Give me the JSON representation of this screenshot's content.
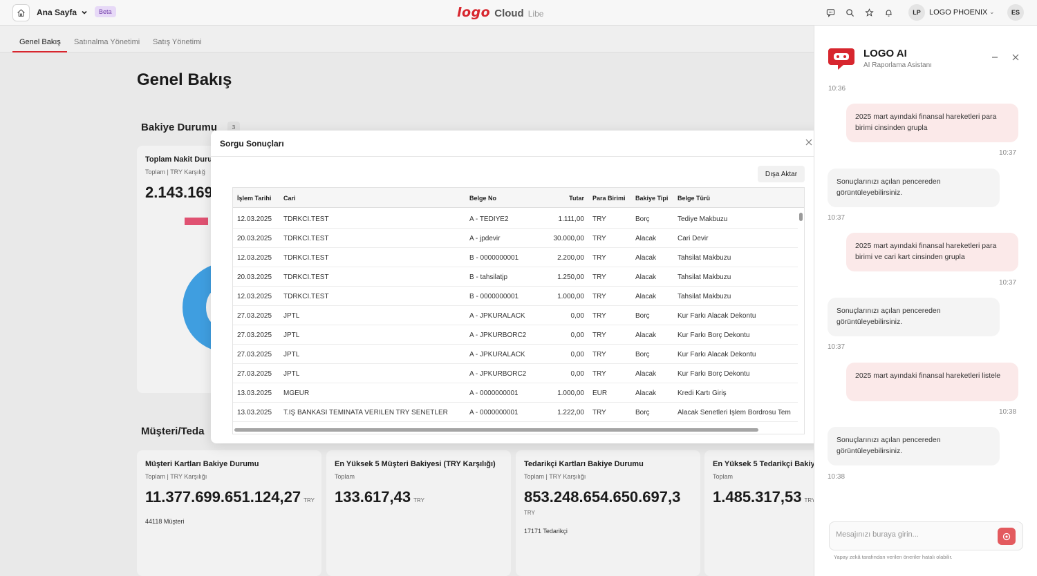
{
  "topbar": {
    "page_label": "Ana Sayfa",
    "beta_label": "Beta",
    "brand_logo": "logo",
    "brand_cloud": "Cloud",
    "brand_suffix": "Libe",
    "user_initials": "LP",
    "company_name": "LOGO PHOENIX",
    "profile_initials": "ES",
    "icons": [
      "chat-icon",
      "search-icon",
      "star-icon",
      "bell-icon"
    ]
  },
  "tabs": [
    {
      "label": "Genel Bakış",
      "active": true
    },
    {
      "label": "Satınalma Yönetimi",
      "active": false
    },
    {
      "label": "Satış Yönetimi",
      "active": false
    }
  ],
  "main": {
    "title": "Genel Bakış",
    "balance_section": {
      "title": "Bakiye Durumu",
      "count": "3"
    },
    "cash_card": {
      "title": "Toplam Nakit Duru",
      "subtitle": "Toplam | TRY Karşılığ",
      "value": "2.143.169"
    },
    "partner_section": {
      "title": "Müşteri/Teda"
    },
    "cards": [
      {
        "title": "Müşteri Kartları Bakiye Durumu",
        "subtitle": "Toplam | TRY Karşılığı",
        "value": "11.377.699.651.124,27",
        "unit": "TRY",
        "note": "44118 Müşteri"
      },
      {
        "title": "En Yüksek 5 Müşteri Bakiyesi (TRY Karşılığı)",
        "subtitle": "Toplam",
        "value": "133.617,43",
        "unit": "TRY",
        "note": ""
      },
      {
        "title": "Tedarikçi Kartları Bakiye Durumu",
        "subtitle": "Toplam | TRY Karşılığı",
        "value": "853.248.654.650.697,3",
        "unit": "TRY",
        "note": "17171 Tedarikçi"
      },
      {
        "title": "En Yüksek 5 Tedarikçi Bakiy",
        "subtitle": "Toplam",
        "value": "1.485.317,53",
        "unit": "TRY",
        "note": ""
      }
    ]
  },
  "modal": {
    "title": "Sorgu Sonuçları",
    "export_label": "Dışa Aktar",
    "columns": [
      "İşlem Tarihi",
      "Cari",
      "Belge No",
      "Tutar",
      "Para Birimi",
      "Bakiye Tipi",
      "Belge Türü"
    ],
    "rows": [
      [
        "12.03.2025",
        "TDRKCI.TEST",
        "A - TEDIYE2",
        "1.111,00",
        "TRY",
        "Borç",
        "Tediye Makbuzu"
      ],
      [
        "20.03.2025",
        "TDRKCI.TEST",
        "A - jpdevir",
        "30.000,00",
        "TRY",
        "Alacak",
        "Cari Devir"
      ],
      [
        "12.03.2025",
        "TDRKCI.TEST",
        "B - 0000000001",
        "2.200,00",
        "TRY",
        "Alacak",
        "Tahsilat Makbuzu"
      ],
      [
        "20.03.2025",
        "TDRKCI.TEST",
        "B - tahsilatjp",
        "1.250,00",
        "TRY",
        "Alacak",
        "Tahsilat Makbuzu"
      ],
      [
        "12.03.2025",
        "TDRKCI.TEST",
        "B - 0000000001",
        "1.000,00",
        "TRY",
        "Alacak",
        "Tahsilat Makbuzu"
      ],
      [
        "27.03.2025",
        "JPTL",
        "A - JPKURALACK",
        "0,00",
        "TRY",
        "Borç",
        "Kur Farkı Alacak Dekontu"
      ],
      [
        "27.03.2025",
        "JPTL",
        "A - JPKURBORC2",
        "0,00",
        "TRY",
        "Alacak",
        "Kur Farkı Borç Dekontu"
      ],
      [
        "27.03.2025",
        "JPTL",
        "A - JPKURALACK",
        "0,00",
        "TRY",
        "Borç",
        "Kur Farkı Alacak Dekontu"
      ],
      [
        "27.03.2025",
        "JPTL",
        "A - JPKURBORC2",
        "0,00",
        "TRY",
        "Alacak",
        "Kur Farkı Borç Dekontu"
      ],
      [
        "13.03.2025",
        "MGEUR",
        "A - 0000000001",
        "1.000,00",
        "EUR",
        "Alacak",
        "Kredi Kartı Giriş"
      ],
      [
        "13.03.2025",
        "T.İŞ BANKASI TEMİNATA VERİLEN TRY SENETLER",
        "A - 0000000001",
        "1.222,00",
        "TRY",
        "Borç",
        "Alacak Senetleri İşlem Bordrosu Tem"
      ]
    ]
  },
  "chat": {
    "title": "LOGO AI",
    "subtitle": "AI Raporlama Asistanı",
    "top_time": "10:36",
    "messages": [
      {
        "role": "user",
        "text": "2025 mart ayındaki finansal hareketleri para birimi cinsinden grupla",
        "time": "10:37"
      },
      {
        "role": "bot",
        "text": "Sonuçlarınızı açılan pencereden görüntüleyebilirsiniz.",
        "time": "10:37"
      },
      {
        "role": "user",
        "text": "2025 mart ayındaki finansal hareketleri para birimi ve cari kart cinsinden grupla",
        "time": "10:37"
      },
      {
        "role": "bot",
        "text": "Sonuçlarınızı açılan pencereden görüntüleyebilirsiniz.",
        "time": "10:37"
      },
      {
        "role": "user",
        "text": "2025 mart ayındaki finansal hareketleri listele",
        "time": "10:38"
      },
      {
        "role": "bot",
        "text": "Sonuçlarınızı açılan pencereden görüntüleyebilirsiniz.",
        "time": "10:38"
      }
    ],
    "input_placeholder": "Mesajınızı buraya girin...",
    "disclaimer": "Yapay zekâ tarafından verilen öneriler hatalı olabilir."
  }
}
